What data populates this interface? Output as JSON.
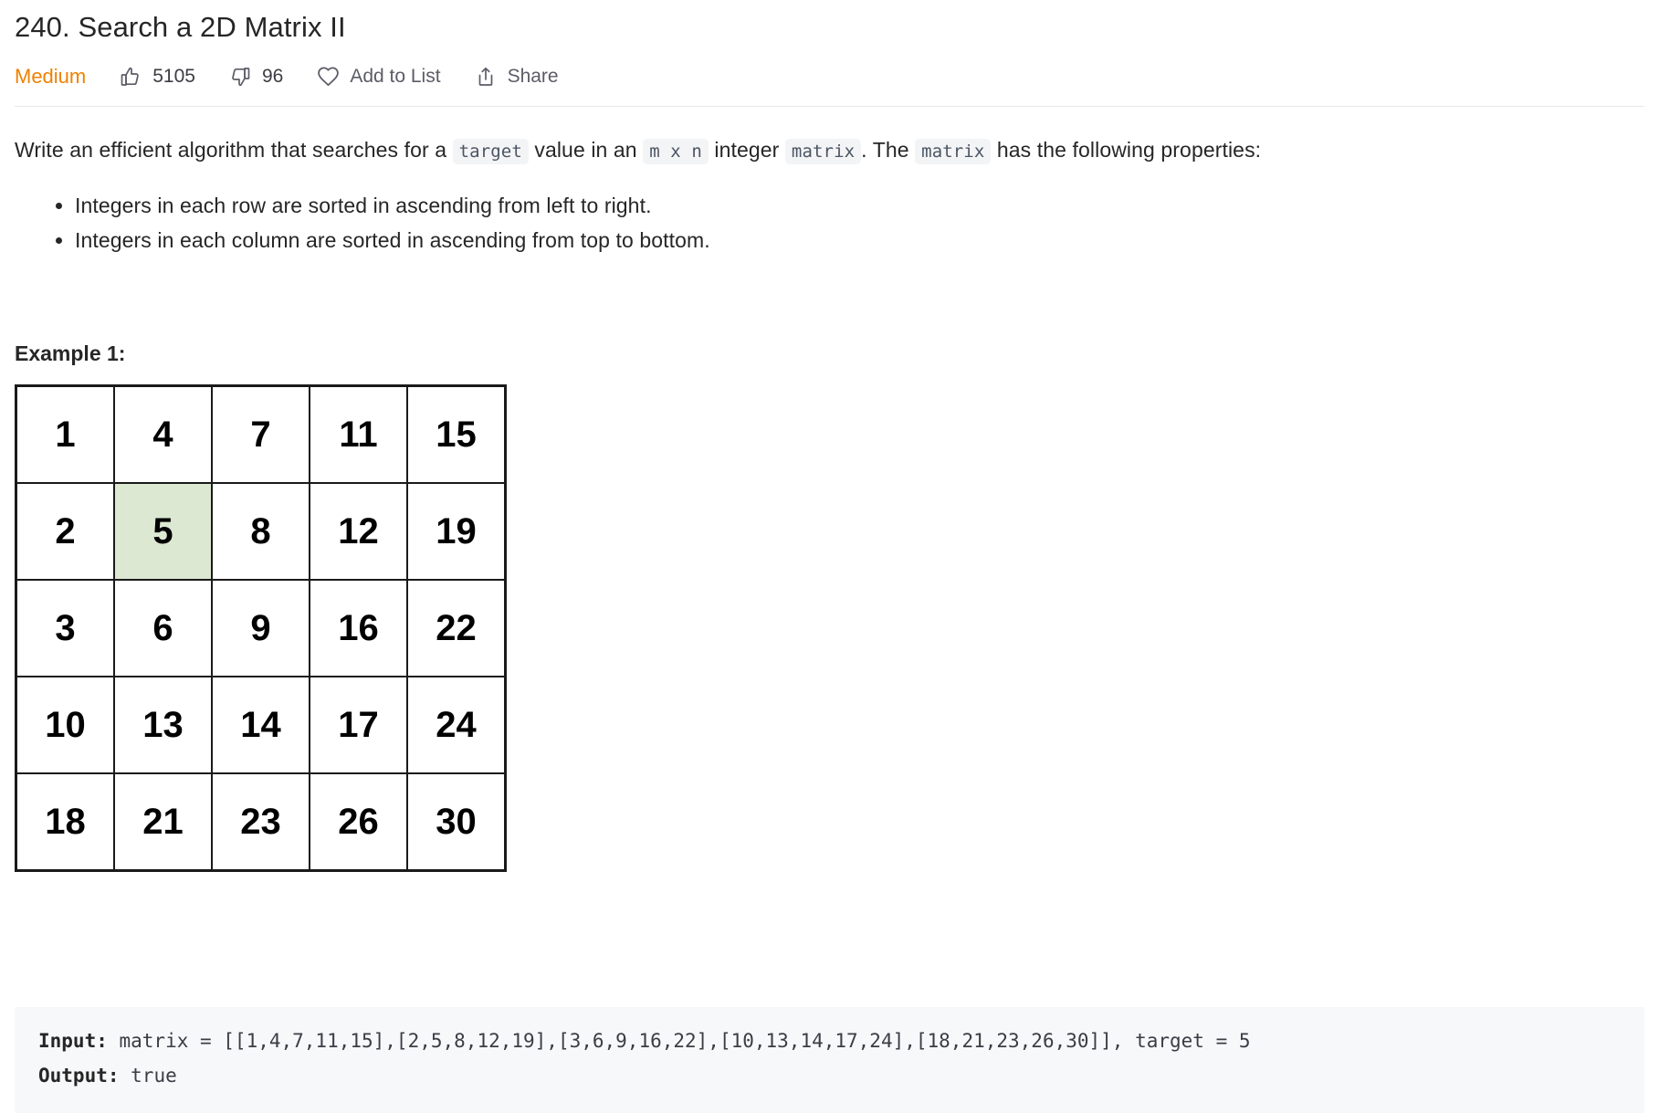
{
  "header": {
    "title": "240. Search a 2D Matrix II",
    "difficulty": "Medium",
    "likes": "5105",
    "dislikes": "96",
    "add_to_list": "Add to List",
    "share": "Share"
  },
  "description": {
    "part1": "Write an efficient algorithm that searches for a ",
    "code1": "target",
    "part2": " value in an ",
    "code2": "m x n",
    "part3": " integer ",
    "code3": "matrix",
    "part4": ". The ",
    "code4": "matrix",
    "part5": " has the following properties:",
    "properties": [
      "Integers in each row are sorted in ascending from left to right.",
      "Integers in each column are sorted in ascending from top to bottom."
    ]
  },
  "example": {
    "heading": "Example 1:",
    "matrix": [
      [
        "1",
        "4",
        "7",
        "11",
        "15"
      ],
      [
        "2",
        "5",
        "8",
        "12",
        "19"
      ],
      [
        "3",
        "6",
        "9",
        "16",
        "22"
      ],
      [
        "10",
        "13",
        "14",
        "17",
        "24"
      ],
      [
        "18",
        "21",
        "23",
        "26",
        "30"
      ]
    ],
    "highlight": {
      "row": 1,
      "col": 1
    },
    "highlight_color": "#dce8d2",
    "input_label": "Input:",
    "input_value": " matrix = [[1,4,7,11,15],[2,5,8,12,19],[3,6,9,16,22],[10,13,14,17,24],[18,21,23,26,30]], target = 5",
    "output_label": "Output:",
    "output_value": " true"
  },
  "colors": {
    "difficulty": "#ef8100",
    "code_bg": "#f3f4f6",
    "codeblock_bg": "#f7f8fa"
  }
}
